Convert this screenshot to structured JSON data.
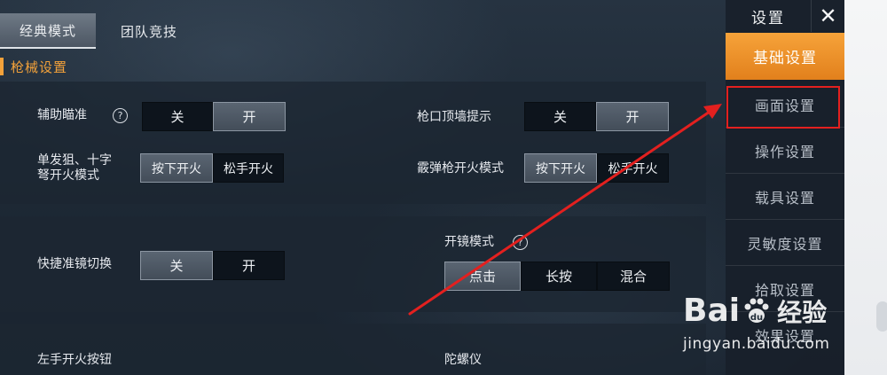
{
  "tabs": [
    {
      "label": "经典模式",
      "active": true
    },
    {
      "label": "团队竞技",
      "active": false
    }
  ],
  "section_title": "枪械设置",
  "settings": {
    "aim_assist": {
      "label": "辅助瞄准",
      "help": "?",
      "options": [
        "关",
        "开"
      ],
      "selected": "开"
    },
    "muzzle_wall_hint": {
      "label": "枪口顶墙提示",
      "options": [
        "关",
        "开"
      ],
      "selected": "开"
    },
    "single_fire_sniper": {
      "label_line1": "单发狙、十字",
      "label_line2": "弩开火模式",
      "options": [
        "按下开火",
        "松手开火"
      ],
      "selected": "按下开火"
    },
    "shotgun_fire_mode": {
      "label": "霰弹枪开火模式",
      "options": [
        "按下开火",
        "松手开火"
      ],
      "selected": "按下开火"
    },
    "quick_scope_switch": {
      "label": "快捷准镜切换",
      "options": [
        "关",
        "开"
      ],
      "selected": "关"
    },
    "scope_mode": {
      "label": "开镜模式",
      "help": "?",
      "options": [
        "点击",
        "长按",
        "混合"
      ],
      "selected": "点击"
    },
    "left_fire_button": {
      "label": "左手开火按钮"
    },
    "gyroscope": {
      "label": "陀螺仪"
    }
  },
  "menu": {
    "title": "设置",
    "close_icon": "close-icon",
    "items": [
      {
        "label": "基础设置",
        "active": true
      },
      {
        "label": "画面设置",
        "active": false
      },
      {
        "label": "操作设置",
        "active": false
      },
      {
        "label": "载具设置",
        "active": false
      },
      {
        "label": "灵敏度设置",
        "active": false
      },
      {
        "label": "拾取设置",
        "active": false
      },
      {
        "label": "效果设置",
        "active": false
      }
    ]
  },
  "annotation": {
    "highlight_color": "#e3201f",
    "arrow_color": "#e3201f"
  },
  "watermark": {
    "brand_left": "Bai",
    "brand_right": "经验",
    "url": "jingyan.baidu.com"
  },
  "colors": {
    "accent_orange": "#f2a13a",
    "menu_active": "#e2801c"
  }
}
